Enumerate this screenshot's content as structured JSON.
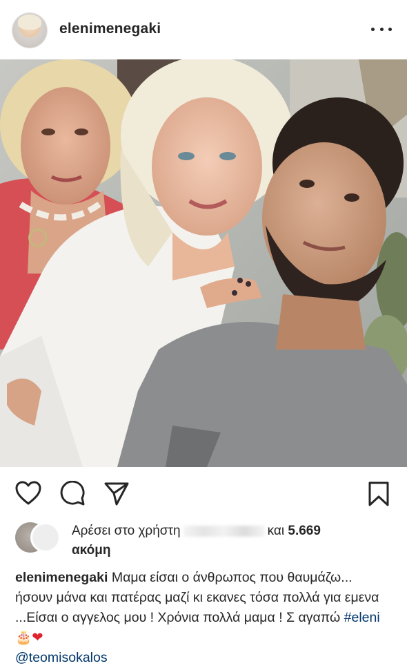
{
  "post": {
    "username": "elenimenegaki",
    "avatar_icon": "profile-avatar",
    "more_icon": "more-dots-icon"
  },
  "photo": {
    "description_icon": "post-photo"
  },
  "actions": {
    "like_icon": "heart-outline-icon",
    "comment_icon": "comment-icon",
    "share_icon": "send-paper-plane-icon",
    "save_icon": "bookmark-icon"
  },
  "likes": {
    "prefix": "Αρέσει στο χρήστη",
    "connector": "και",
    "count": "5.669",
    "suffix": "ακόμη"
  },
  "caption": {
    "username": "elenimenegaki",
    "text": "Μαμα είσαι ο άνθρωπος που θαυμάζω... ήσουν μάνα και πατέρας μαζί κι εκανες τόσα πολλά για εμενα ...Είσαι ο αγγελος μου ! Χρόνια πολλά μαμα ! Σ αγαπώ",
    "hashtag": "#eleni",
    "emoji_cake": "🎂",
    "emoji_heart": "❤",
    "mention": "@teomisokalos"
  },
  "colors": {
    "link": "#00376b",
    "text": "#262626",
    "heart": "#e0242f"
  }
}
